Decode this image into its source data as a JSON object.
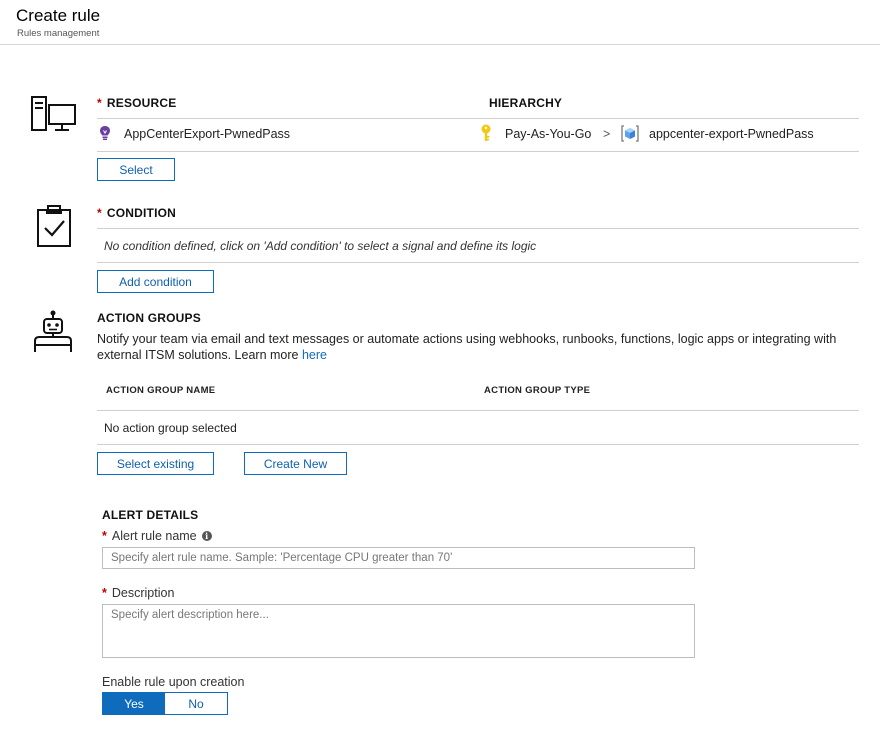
{
  "header": {
    "title": "Create rule",
    "subtitle": "Rules management"
  },
  "resource": {
    "heading": "RESOURCE",
    "hierarchy_heading": "HIERARCHY",
    "name": "AppCenterExport-PwnedPass",
    "subscription": "Pay-As-You-Go",
    "separator": ">",
    "resource_group": "appcenter-export-PwnedPass",
    "select_button": "Select"
  },
  "condition": {
    "heading": "CONDITION",
    "empty_text": "No condition defined, click on 'Add condition' to select a signal and define its logic",
    "add_button": "Add condition"
  },
  "action_groups": {
    "heading": "ACTION GROUPS",
    "description_line1": "Notify your team via email and text messages or automate actions using webhooks, runbooks, functions, logic apps or integrating with",
    "description_line2": "external ITSM solutions. Learn more",
    "link_text": "here",
    "columns": [
      "ACTION GROUP NAME",
      "ACTION GROUP TYPE"
    ],
    "empty_text": "No action group selected",
    "select_existing_button": "Select existing",
    "create_new_button": "Create New"
  },
  "alert_details": {
    "heading": "ALERT DETAILS",
    "rule_name_label": "Alert rule name",
    "rule_name_placeholder": "Specify alert rule name. Sample: 'Percentage CPU greater than 70'",
    "description_label": "Description",
    "description_placeholder": "Specify alert description here...",
    "enable_label": "Enable rule upon creation",
    "enable_options": [
      "Yes",
      "No"
    ],
    "enable_selected": "Yes"
  },
  "colors": {
    "accent": "#0f6cbd",
    "required": "#c00000",
    "key_icon": "#f2c811",
    "purple_icon": "#6b3fa0"
  },
  "required_marker": "*",
  "info_glyph": "i"
}
